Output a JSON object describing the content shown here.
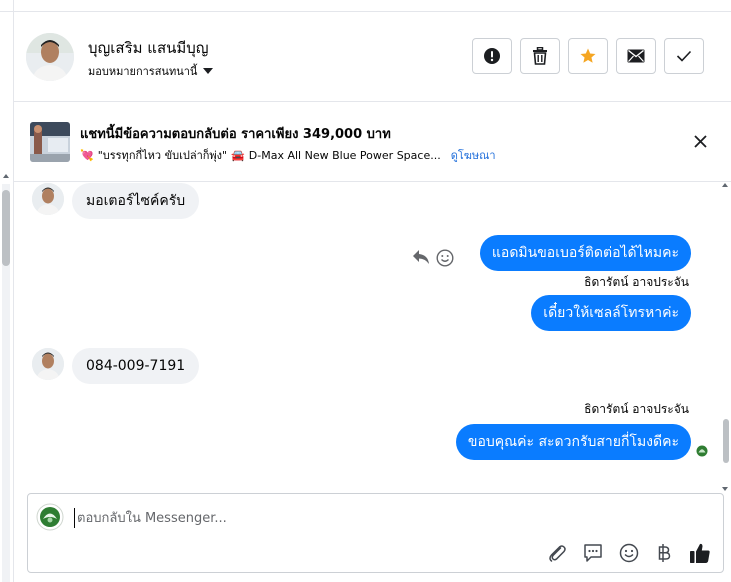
{
  "header": {
    "contact_name": "บุญเสริม แสนมีบุญ",
    "assign_label": "มอบหมายการสนทนานี้",
    "buttons": [
      "report-icon",
      "trash-icon",
      "star-icon",
      "envelope-icon",
      "check-icon"
    ],
    "star_color": "#f5a623"
  },
  "banner": {
    "title": "แชทนี้มีข้อความตอบกลับต่อ ราคาเพียง 349,000 บาท",
    "subtitle_emoji_1": "💘",
    "subtitle_quote": "\"บรรทุกกี่ไหว ขับเปล่าก็พุ่ง\"",
    "subtitle_emoji_2": "🚘",
    "subtitle_text": "D-Max All New Blue Power Space...",
    "link": "ดูโฆษณา"
  },
  "messages": [
    {
      "direction": "in",
      "text": "มอเตอร์ไซค์ครับ"
    },
    {
      "direction": "out",
      "text": "แอดมินขอเบอร์ติดต่อได้ไหมคะ"
    },
    {
      "direction": "out",
      "sender": "ธิดารัตน์ อาจประจัน",
      "text": "เดี๋ยวให้เซลล์โทรหาค่ะ"
    },
    {
      "direction": "in",
      "text": "084-009-7191"
    },
    {
      "direction": "out",
      "sender": "ธิดารัตน์ อาจประจัน",
      "text": "ขอบคุณค่ะ สะดวกรับสายกี่โมงดีคะ"
    }
  ],
  "composer": {
    "placeholder": "ตอบกลับใน Messenger...",
    "tools": [
      "attachment-icon",
      "saved-replies-icon",
      "emoji-icon",
      "baht-icon",
      "like-icon"
    ]
  },
  "colors": {
    "accent": "#0a7cff",
    "link": "#216fdb",
    "incoming_bubble": "#f0f2f5"
  }
}
